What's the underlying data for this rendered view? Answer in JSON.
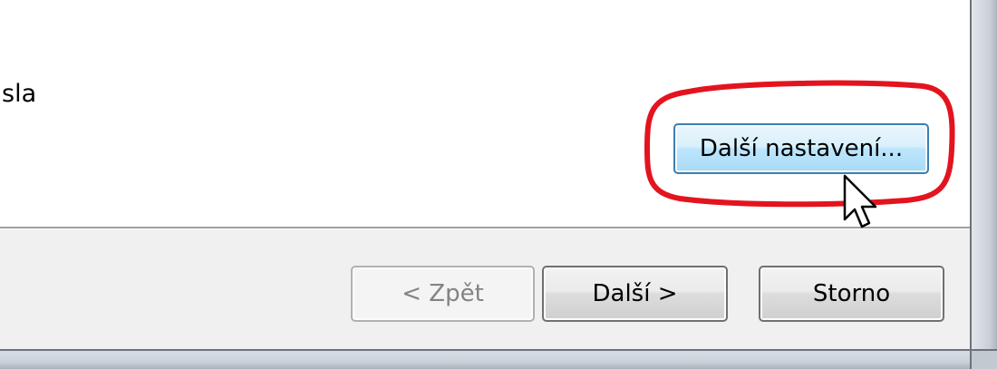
{
  "wizard": {
    "content": {
      "partial_label": "sla",
      "more_settings_button": "Další nastavení..."
    },
    "footer": {
      "back_button": "< Zpět",
      "next_button": "Další >",
      "cancel_button": "Storno"
    }
  },
  "annotation": {
    "highlight_color": "#e3141e",
    "cursor_icon": "mouse-pointer-icon"
  }
}
